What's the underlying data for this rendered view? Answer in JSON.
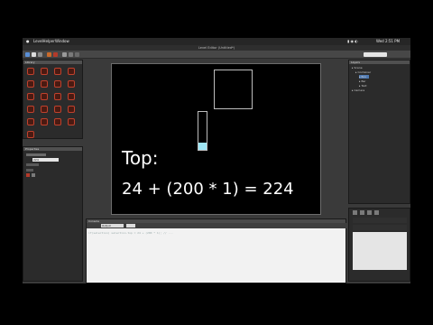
{
  "menubar": {
    "app_name": "LevelHelper",
    "menu": "Window",
    "status_time": "Wed 2:51 PM"
  },
  "window": {
    "title": "Level Editor (Untitled*)"
  },
  "stage": {
    "line1": "Top:",
    "line2": "24 + (200 * 1) = 224"
  },
  "left_panel": {
    "header": "Library",
    "items": [
      "sprite",
      "sprite",
      "sprite",
      "sprite",
      "sprite",
      "sprite",
      "sprite",
      "sprite",
      "sprite",
      "sprite",
      "sprite",
      "sprite",
      "sprite",
      "sprite",
      "sprite",
      "sprite",
      "sprite",
      "sprite",
      "sprite",
      "sprite",
      "sprite"
    ]
  },
  "properties_panel": {
    "header": "Properties",
    "field_value": "224"
  },
  "outliner": {
    "header": "Layers",
    "rows": [
      "Scene",
      "Container",
      "Box",
      "Bar",
      "Text",
      "Camera"
    ]
  },
  "console": {
    "header": "Console",
    "tab": "Output",
    "code": "if(selection) selection.top = 24 + (200 * 1); // ..."
  },
  "colors": {
    "accent": "#c0412c",
    "selection": "#4f79b0",
    "fill": "#9fe6f5"
  }
}
